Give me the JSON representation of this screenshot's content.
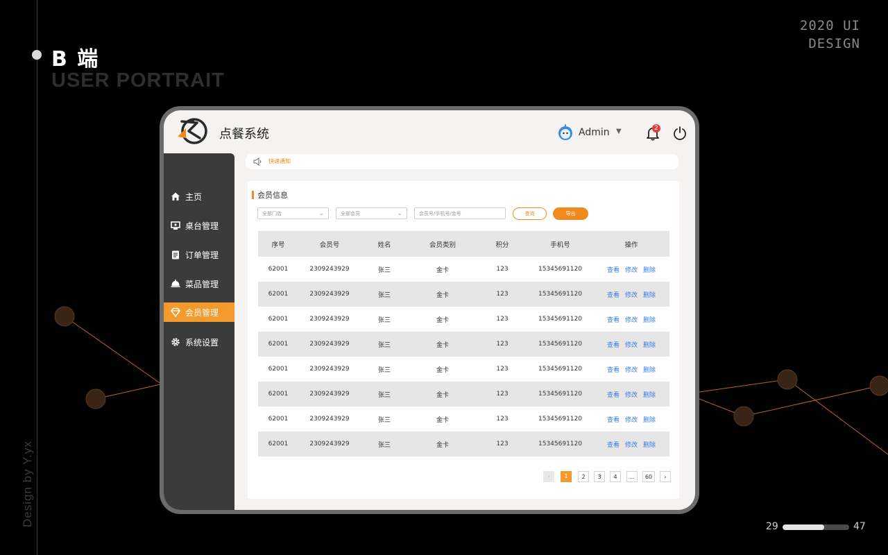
{
  "slide": {
    "title": "B 端",
    "subtitle": "USER PORTRAIT",
    "corner_line1": "2020 UI",
    "corner_line2": "DESIGN",
    "credit": "Design by Y.yx",
    "page_current": "29",
    "page_total": "47",
    "progress": 0.62
  },
  "app": {
    "title": "点餐系统",
    "user": "Admin",
    "notification_count": "2",
    "notice": "快速通知"
  },
  "sidebar": {
    "items": [
      {
        "label": "主页",
        "icon": "home-icon"
      },
      {
        "label": "桌台管理",
        "icon": "monitor-icon"
      },
      {
        "label": "订单管理",
        "icon": "clipboard-icon"
      },
      {
        "label": "菜品管理",
        "icon": "cloche-icon"
      },
      {
        "label": "会员管理",
        "icon": "diamond-icon",
        "active": true
      },
      {
        "label": "系统设置",
        "icon": "gear-icon"
      }
    ]
  },
  "panel": {
    "title": "会员信息",
    "filter_store": "全部门店",
    "filter_member": "全部会员",
    "search_placeholder": "会员号/手机号/会号",
    "query_label": "查询",
    "export_label": "导出"
  },
  "table": {
    "headers": [
      "序号",
      "会员号",
      "姓名",
      "会员类别",
      "积分",
      "手机号",
      "操作"
    ],
    "actions": [
      "查看",
      "修改",
      "删除"
    ],
    "rows": [
      [
        "62001",
        "2309243929",
        "张三",
        "金卡",
        "123",
        "15345691120"
      ],
      [
        "62001",
        "2309243929",
        "张三",
        "金卡",
        "123",
        "15345691120"
      ],
      [
        "62001",
        "2309243929",
        "张三",
        "金卡",
        "123",
        "15345691120"
      ],
      [
        "62001",
        "2309243929",
        "张三",
        "金卡",
        "123",
        "15345691120"
      ],
      [
        "62001",
        "2309243929",
        "张三",
        "金卡",
        "123",
        "15345691120"
      ],
      [
        "62001",
        "2309243929",
        "张三",
        "金卡",
        "123",
        "15345691120"
      ],
      [
        "62001",
        "2309243929",
        "张三",
        "金卡",
        "123",
        "15345691120"
      ],
      [
        "62001",
        "2309243929",
        "张三",
        "金卡",
        "123",
        "15345691120"
      ]
    ]
  },
  "pagination": {
    "prev": "‹",
    "pages": [
      "1",
      "2",
      "3",
      "4",
      "...",
      "60"
    ],
    "current": "1",
    "next": "›"
  },
  "colors": {
    "accent": "#f39a2c",
    "link": "#3b7ee6",
    "sidebar": "#3b3b3b",
    "background": "#000000"
  }
}
